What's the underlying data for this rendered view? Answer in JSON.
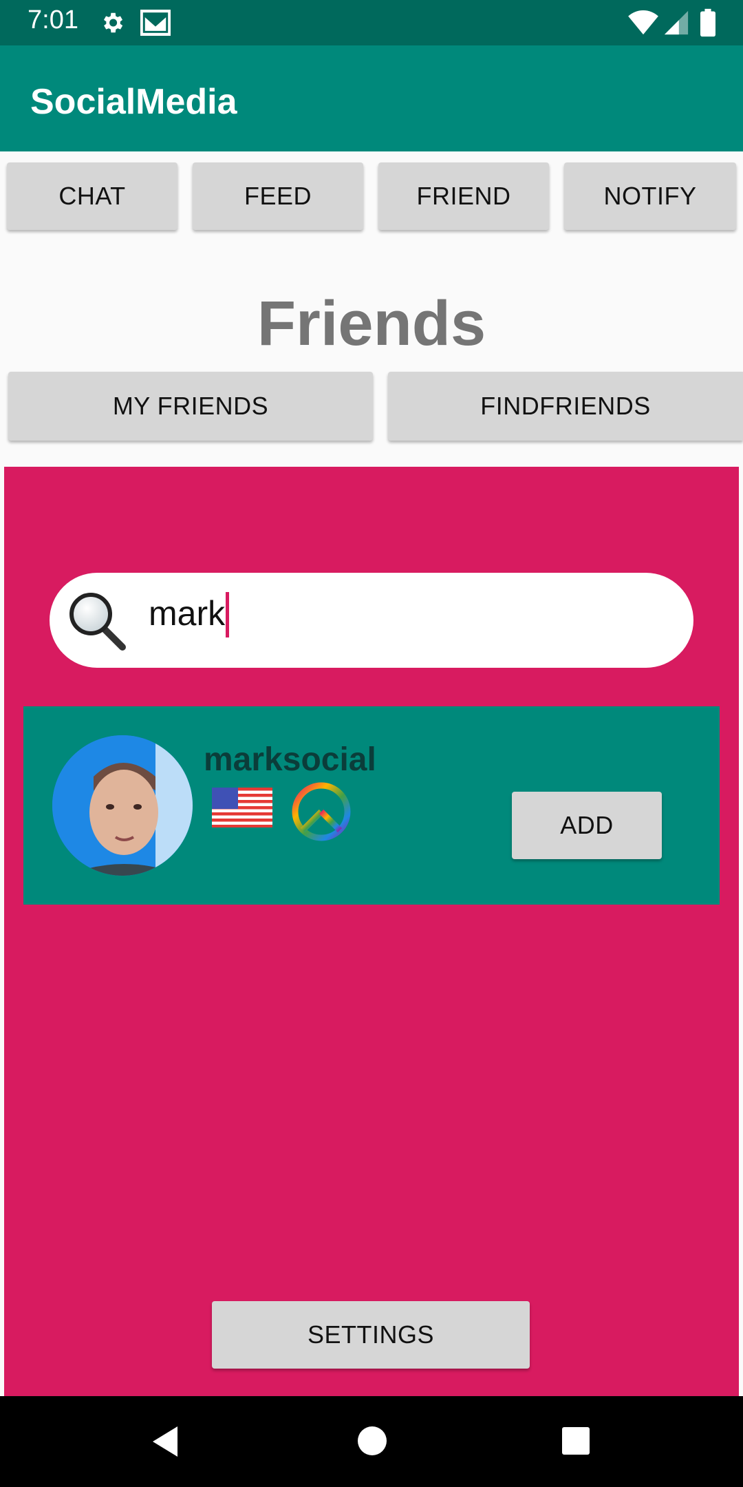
{
  "status_bar": {
    "time": "7:01"
  },
  "app": {
    "title": "SocialMedia"
  },
  "top_tabs": [
    "CHAT",
    "FEED",
    "FRIEND",
    "NOTIFY"
  ],
  "page": {
    "title": "Friends"
  },
  "friend_tabs": {
    "my_friends": "MY FRIENDS",
    "find_friends": "FINDFRIENDS"
  },
  "search": {
    "value": "mark"
  },
  "result": {
    "username": "marksocial",
    "add_label": "ADD"
  },
  "settings_label": "SETTINGS",
  "colors": {
    "status_bar": "#00695c",
    "app_bar": "#00897b",
    "panel": "#d81b60",
    "card": "#00897b"
  },
  "icons": [
    "settings-gear-icon",
    "gmail-icon",
    "wifi-icon",
    "signal-icon",
    "battery-icon",
    "search-icon",
    "us-flag-icon",
    "peace-sign-icon",
    "back-icon",
    "home-icon",
    "recents-icon"
  ]
}
